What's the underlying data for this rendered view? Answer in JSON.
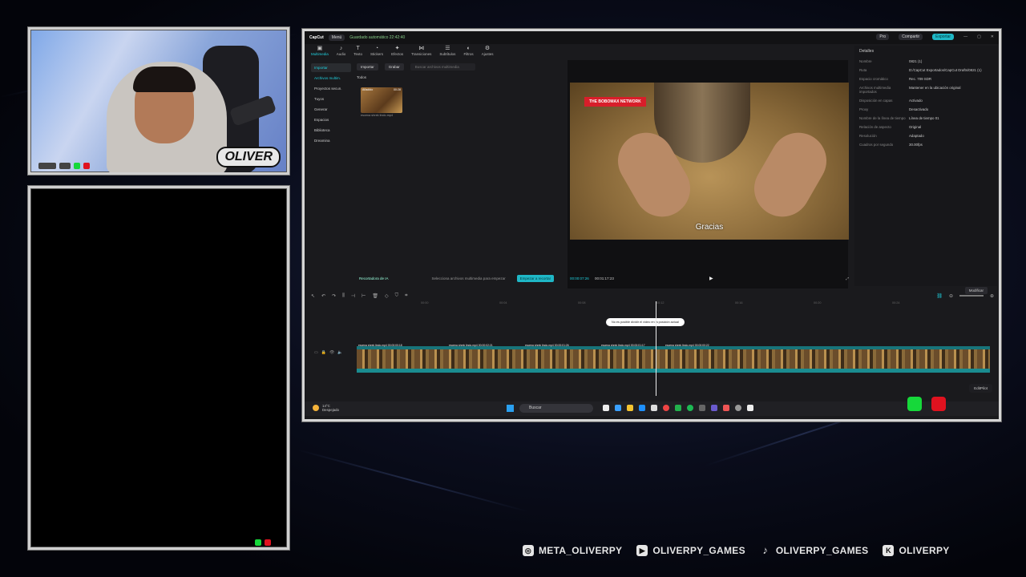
{
  "overlay": {
    "cam_logo": "OLIVER",
    "social": [
      {
        "icon": "instagram-icon",
        "handle": "META_OLIVERPY"
      },
      {
        "icon": "youtube-icon",
        "handle": "OLIVERPY_GAMES"
      },
      {
        "icon": "tiktok-icon",
        "handle": "OLIVERPY_GAMES"
      },
      {
        "icon": "kick-icon",
        "handle": "OLIVERPY"
      }
    ]
  },
  "capcut": {
    "app_name": "CapCut",
    "menu": "Menú",
    "autosave": "Guardado automático 22:42:40",
    "pro": "Pro",
    "share": "Compartir",
    "export": "Exportar",
    "tools": [
      "Multimedia",
      "Audio",
      "Texto",
      "Stickers",
      "Efectos",
      "Transiciones",
      "Subtítulos",
      "Filtros",
      "Ajustes"
    ],
    "sidebar": [
      "Importar",
      "Archivos multim.",
      "Proyectos secun.",
      "Tuyos",
      "Generar",
      "Espacios",
      "Biblioteca",
      "Dreamina"
    ],
    "media": {
      "import": "Importar",
      "record": "Grabar",
      "search_placeholder": "Buscar archivos multimedia",
      "all": "Todos",
      "thumb_tag": "Añadido",
      "thumb_duration": "00:28",
      "thumb_label": "escena shrek lindo.mp4"
    },
    "ai_bar": {
      "label": "Recortadora de IA",
      "hint": "Selecciona archivos multimedia para empezar",
      "cta": "Empezar a recortar"
    },
    "viewer": {
      "badge": "THE BOBOMAX NETWORK",
      "subtitle": "Gracias",
      "time_current": "00:00:07:26",
      "time_total": "00:01:17:23"
    },
    "details": {
      "title": "Detalles",
      "rows": [
        {
          "k": "Nombre",
          "v": "0821 (1)"
        },
        {
          "k": "Ruta",
          "v": "D:/CapCut Exportados/CapCut Drafts/0821 (1)"
        },
        {
          "k": "Espacio cromático",
          "v": "Rec. 709 SDR"
        },
        {
          "k": "Archivos multimedia importados",
          "v": "Mantener en la ubicación original"
        },
        {
          "k": "Disposición en capas",
          "v": "Activado"
        },
        {
          "k": "Proxy",
          "v": "Desactivado"
        },
        {
          "k": "Nombre de la línea de tiempo",
          "v": "Línea de tiempo 01"
        },
        {
          "k": "Relación de aspecto",
          "v": "Original"
        },
        {
          "k": "Resolución",
          "v": "Adaptado"
        },
        {
          "k": "Cuadros por segundo",
          "v": "30.00fps"
        }
      ],
      "modify": "Modificar"
    },
    "timeline": {
      "ticks": [
        "00:00",
        "00:04",
        "00:08",
        "00:12",
        "00:16",
        "00:20",
        "00:24"
      ],
      "tooltip": "No es posible dividir el vídeo en la posición actual",
      "clip_labels": [
        "escena shrek lindo.mp4  00:00:00:18",
        "escena shrek lindo.mp4  00:00:02:21",
        "escena shrek lindo.mp4  00:00:01:26",
        "escena shrek lindo.mp4  00:00:01:17",
        "escena shrek lindo.mp4  00:00:00:22"
      ],
      "editpilot": "EditPilot"
    },
    "taskbar": {
      "temp": "14°C",
      "weather": "Despejado",
      "search": "Buscar"
    }
  },
  "colors": {
    "accent": "#1fd0de",
    "brand_red": "#d81e2a",
    "rec_green": "#16d83a",
    "rec_red": "#e0121f"
  }
}
